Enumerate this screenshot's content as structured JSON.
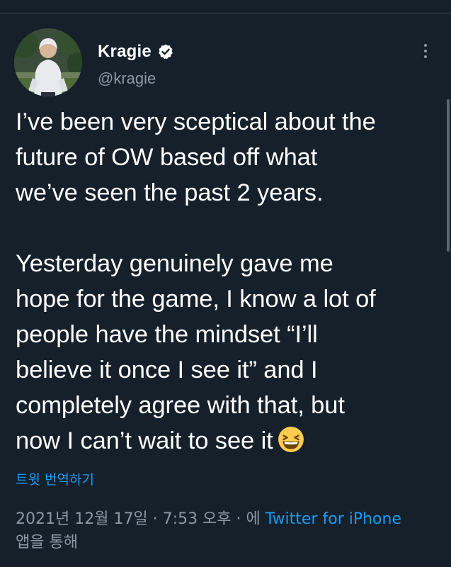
{
  "user": {
    "display_name": "Kragie",
    "handle": "@kragie"
  },
  "tweet": {
    "lines": [
      "I’ve been very sceptical about the",
      "future of OW based off what",
      "we’ve seen the past 2 years.",
      "",
      "Yesterday genuinely gave me",
      "hope for the game, I know a lot of",
      "people have the mindset “I’ll",
      "believe it once I see it” and I",
      "completely agree with that, but",
      "now I can’t wait to see it"
    ],
    "emoji": "grinning-squinting-face",
    "translate_label": "트윗 번역하기"
  },
  "meta": {
    "timestamp": "2021년 12월 17일 · 7:53 오후 · ",
    "via_prefix": "에 ",
    "source": "Twitter for iPhone",
    "suffix": "앱을 통해"
  },
  "colors": {
    "background": "#15202b",
    "accent": "#1d9bf0",
    "secondary_text": "#8b98a5"
  }
}
